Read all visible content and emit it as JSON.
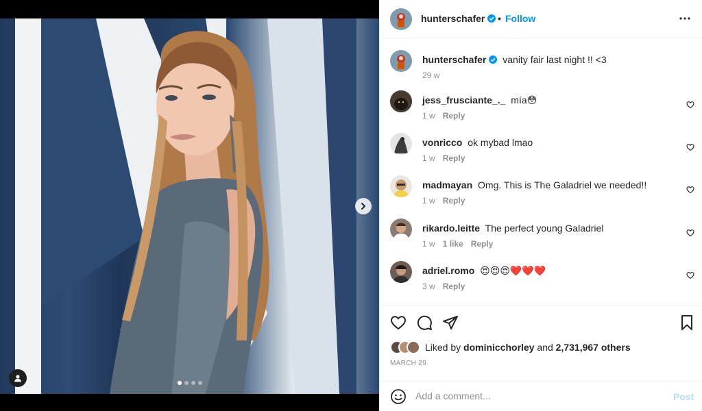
{
  "post": {
    "author": "hunterschafer",
    "follow_label": "Follow",
    "separator": "•",
    "caption": {
      "username": "hunterschafer",
      "text": "vanity fair last night !! <3",
      "time": "29 w"
    },
    "media": {
      "carousel_dots": 4,
      "active_dot": 0
    }
  },
  "comments": [
    {
      "username": "jess_frusciante_._",
      "text": "mía😳",
      "time": "1 w",
      "likes": "",
      "reply_label": "Reply",
      "avatar_color": "#3b2f27"
    },
    {
      "username": "vonricco",
      "text": "ok mybad lmao",
      "time": "1 w",
      "likes": "",
      "reply_label": "Reply",
      "avatar_color": "#d9d9d9"
    },
    {
      "username": "madmayan",
      "text": "Omg. This is The Galadriel we needed!!",
      "time": "1 w",
      "likes": "",
      "reply_label": "Reply",
      "avatar_color": "#c99a6b"
    },
    {
      "username": "rikardo.leitte",
      "text": "The perfect young Galadriel",
      "time": "1 w",
      "likes": "1 like",
      "reply_label": "Reply",
      "avatar_color": "#6b5a4e"
    },
    {
      "username": "adriel.romo",
      "text": "😍😍😍❤️❤️❤️",
      "time": "3 w",
      "likes": "",
      "reply_label": "Reply",
      "avatar_color": "#5a4a40"
    }
  ],
  "engagement": {
    "liked_by_prefix": "Liked by",
    "liked_by_user": "dominicchorley",
    "and_label": "and",
    "others": "2,731,967 others",
    "date": "MARCH 29"
  },
  "add_comment": {
    "placeholder": "Add a comment...",
    "post_label": "Post"
  },
  "colors": {
    "link_blue": "#0095f6",
    "post_disabled": "#b2dffc",
    "muted": "#8e8e8e",
    "text": "#262626",
    "verified": "#0095f6"
  },
  "icons": [
    "chevron-right-icon",
    "user-tag-icon",
    "verified-icon",
    "more-icon",
    "heart-icon",
    "comment-icon",
    "share-icon",
    "bookmark-icon",
    "emoji-icon"
  ]
}
